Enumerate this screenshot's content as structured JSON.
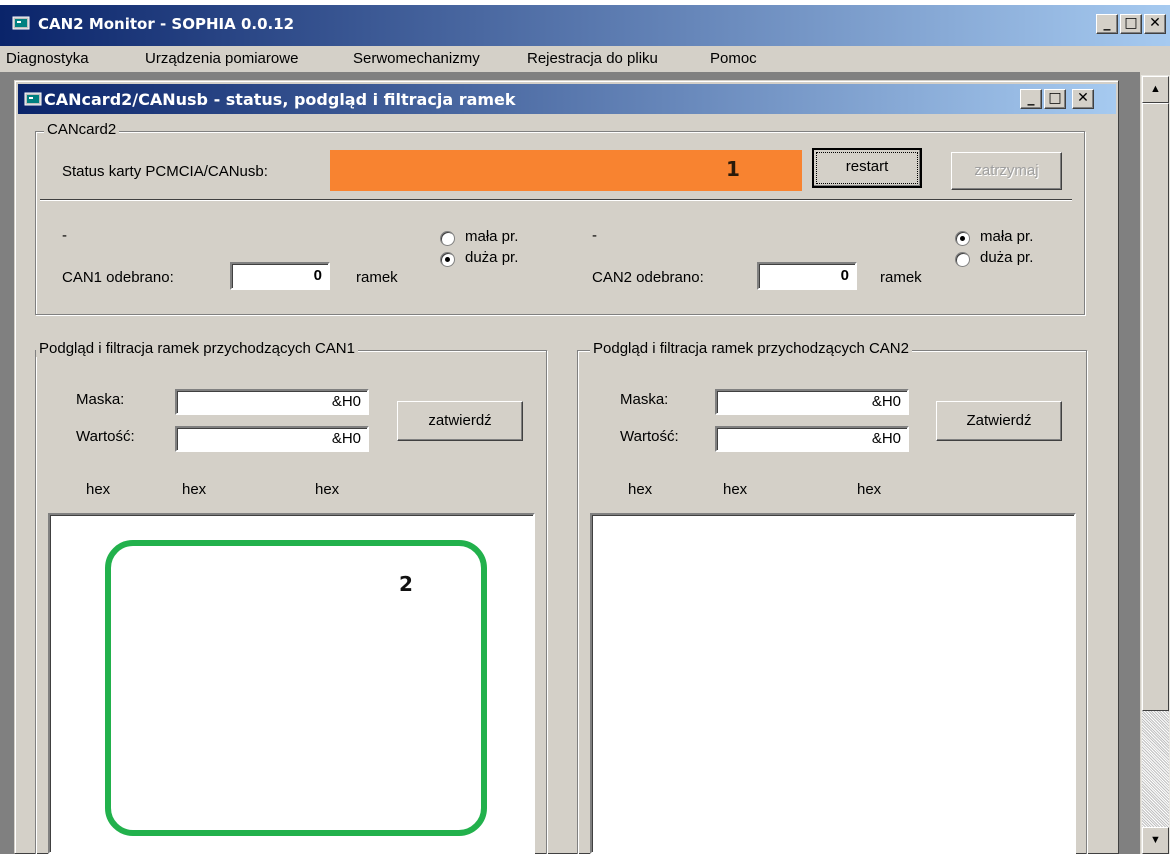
{
  "app": {
    "title": "CAN2 Monitor - SOPHIA 0.0.12",
    "title_icon": "app-window-icon"
  },
  "menu": {
    "items": [
      {
        "label": "Diagnostyka"
      },
      {
        "label": "Urządzenia pomiarowe"
      },
      {
        "label": "Serwomechanizmy"
      },
      {
        "label": "Rejestracja do pliku"
      },
      {
        "label": "Pomoc"
      }
    ]
  },
  "window_controls": {
    "minimize": "_",
    "maximize": "□",
    "close": "✕"
  },
  "child_window": {
    "title": "CANcard2/CANusb - status, podgląd i filtracja ramek"
  },
  "cancard": {
    "group_label": "CANcard2",
    "status_label": "Status karty PCMCIA/CANusb:",
    "status_color": "#f88330",
    "annotation_1": "1",
    "restart_label": "restart",
    "stop_label": "zatrzymaj",
    "can1": {
      "dash": "-",
      "label": "CAN1 odebrano:",
      "value": "0",
      "unit": "ramek",
      "speed_low": "mała pr.",
      "speed_high": "duża pr.",
      "selected": "high"
    },
    "can2": {
      "dash": "-",
      "label": "CAN2 odebrano:",
      "value": "0",
      "unit": "ramek",
      "speed_low": "mała pr.",
      "speed_high": "duża pr.",
      "selected": "low"
    }
  },
  "filter_can1": {
    "group_label": "Podgląd i filtracja ramek przychodzących CAN1",
    "mask_label": "Maska:",
    "mask_value": "&H0",
    "value_label": "Wartość:",
    "value_value": "&H0",
    "confirm_label": "zatwierdź",
    "columns": [
      "hex",
      "hex",
      "hex"
    ],
    "annotation_2": "2",
    "annotation_color": "#22b14c"
  },
  "filter_can2": {
    "group_label": "Podgląd i filtracja ramek przychodzących CAN2",
    "mask_label": "Maska:",
    "mask_value": "&H0",
    "value_label": "Wartość:",
    "value_value": "&H0",
    "confirm_label": "Zatwierdź",
    "columns": [
      "hex",
      "hex",
      "hex"
    ]
  }
}
